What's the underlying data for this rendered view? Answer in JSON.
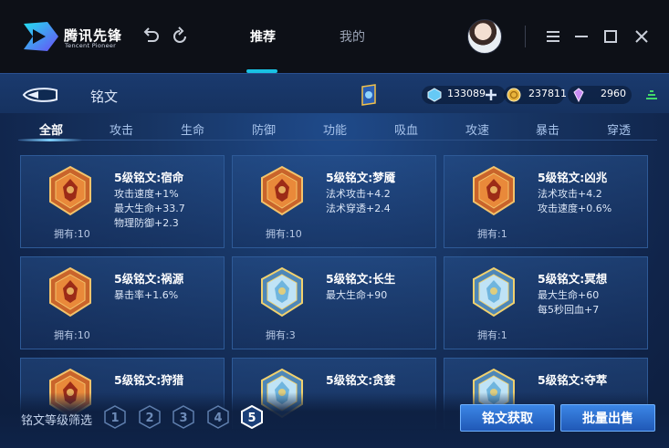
{
  "app": {
    "logo_text": "腾讯先锋",
    "logo_subtitle": "Tencent Pioneer",
    "nav_tabs": [
      {
        "label": "推荐",
        "active": true
      },
      {
        "label": "我的",
        "active": false
      }
    ],
    "accent_color": "#19c2e4"
  },
  "page": {
    "title": "铭文",
    "resources": {
      "diamond": "133089",
      "gold": "237811",
      "gem": "2960"
    },
    "category_tabs": [
      "全部",
      "攻击",
      "生命",
      "防御",
      "功能",
      "吸血",
      "攻速",
      "暴击",
      "穿透"
    ],
    "active_tab": "全部"
  },
  "inscriptions": [
    {
      "name": "5级铭文:宿命",
      "attrs": [
        "攻击速度+1%",
        "最大生命+33.7",
        "物理防御+2.3"
      ],
      "owned": "拥有:10",
      "color": "red",
      "icon": "flame-icon"
    },
    {
      "name": "5级铭文:梦魇",
      "attrs": [
        "法术攻击+4.2",
        "法术穿透+2.4"
      ],
      "owned": "拥有:10",
      "color": "red",
      "icon": "demon-wing-icon"
    },
    {
      "name": "5级铭文:凶兆",
      "attrs": [
        "法术攻击+4.2",
        "攻击速度+0.6%"
      ],
      "owned": "拥有:1",
      "color": "red",
      "icon": "omen-icon"
    },
    {
      "name": "5级铭文:祸源",
      "attrs": [
        "暴击率+1.6%"
      ],
      "owned": "拥有:10",
      "color": "red",
      "icon": "blade-icon"
    },
    {
      "name": "5级铭文:长生",
      "attrs": [
        "最大生命+90"
      ],
      "owned": "拥有:3",
      "color": "blue",
      "icon": "leaf-icon"
    },
    {
      "name": "5级铭文:冥想",
      "attrs": [
        "最大生命+60",
        "每5秒回血+7"
      ],
      "owned": "拥有:1",
      "color": "blue",
      "icon": "star-icon"
    },
    {
      "name": "5级铭文:狩猎",
      "attrs": [],
      "owned": "",
      "color": "red",
      "icon": "hunt-icon"
    },
    {
      "name": "5级铭文:贪婪",
      "attrs": [],
      "owned": "",
      "color": "blue",
      "icon": "greed-icon"
    },
    {
      "name": "5级铭文:夺萃",
      "attrs": [],
      "owned": "",
      "color": "blue",
      "icon": "plunder-icon"
    }
  ],
  "footer": {
    "filter_label": "铭文等级筛选",
    "levels": [
      "1",
      "2",
      "3",
      "4",
      "5"
    ],
    "active_level": "5",
    "btn_obtain": "铭文获取",
    "btn_sell": "批量出售"
  }
}
